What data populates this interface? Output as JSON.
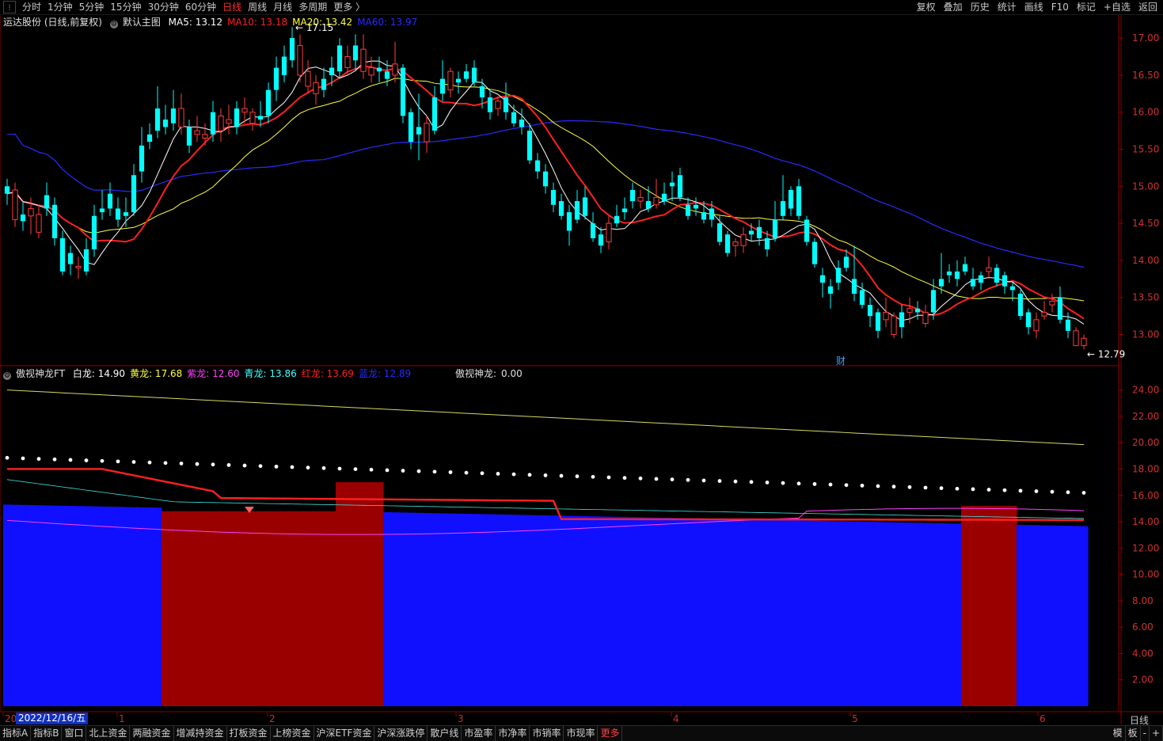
{
  "topbar": {
    "periods": [
      "分时",
      "1分钟",
      "5分钟",
      "15分钟",
      "30分钟",
      "60分钟",
      "日线",
      "周线",
      "月线",
      "多周期",
      "更多 〉"
    ],
    "active_period": "日线",
    "right_buttons": [
      "复权",
      "叠加",
      "历史",
      "统计",
      "画线",
      "F10",
      "标记",
      "+自选",
      "返回"
    ]
  },
  "main_panel": {
    "stock_label": "运达股份 (日线,前复权)",
    "template_label": "默认主图",
    "ma": [
      {
        "label": "MA5:",
        "value": "13.12",
        "color": "#ffffff"
      },
      {
        "label": "MA10:",
        "value": "13.18",
        "color": "#ff2020"
      },
      {
        "label": "MA20:",
        "value": "13.42",
        "color": "#ffff40"
      },
      {
        "label": "MA60:",
        "value": "13.97",
        "color": "#2a2aff"
      }
    ],
    "high_marker": "17.15",
    "low_marker": "12.79",
    "event_marker": "财",
    "y_ticks": [
      "17.00",
      "16.50",
      "16.00",
      "15.50",
      "15.00",
      "14.50",
      "14.00",
      "13.50",
      "13.00"
    ]
  },
  "sub_panel": {
    "indicator_label": "傲视神龙FT",
    "values": [
      {
        "label": "白龙:",
        "value": "14.90",
        "color": "#ffffff"
      },
      {
        "label": "黄龙:",
        "value": "17.68",
        "color": "#ffff40"
      },
      {
        "label": "紫龙:",
        "value": "12.60",
        "color": "#ff40ff"
      },
      {
        "label": "青龙:",
        "value": "13.86",
        "color": "#40ffff"
      },
      {
        "label": "红龙:",
        "value": "13.69",
        "color": "#ff2020"
      },
      {
        "label": "蓝龙:",
        "value": "12.89",
        "color": "#2a2aff"
      }
    ],
    "extra_label": "傲视神龙:",
    "extra_value": "0.00",
    "y_ticks": [
      "24.00",
      "22.00",
      "20.00",
      "18.00",
      "16.00",
      "14.00",
      "12.00",
      "10.00",
      "8.00",
      "6.00",
      "4.00",
      "2.00"
    ]
  },
  "xaxis": {
    "cursor_date": "2022/12/16/五",
    "year_prefix": "20",
    "month_ticks": [
      "1",
      "2",
      "3",
      "4",
      "5",
      "6"
    ],
    "period_label": "日线"
  },
  "bottombar": {
    "tabs": [
      "指标A",
      "指标B",
      "窗口",
      "北上资金",
      "两融资金",
      "增减持资金",
      "打板资金",
      "上榜资金",
      "沪深ETF资金",
      "沪深涨跌停",
      "散户线",
      "市盈率",
      "市净率",
      "市销率",
      "市现率",
      "更多"
    ],
    "right": [
      "模",
      "板",
      "-",
      "+"
    ]
  },
  "chart_data": {
    "type": "candlestick",
    "candles": [
      [
        15.0,
        14.9,
        15.1,
        14.75
      ],
      [
        14.55,
        14.95,
        15.05,
        14.45
      ],
      [
        14.62,
        14.53,
        14.8,
        14.4
      ],
      [
        14.6,
        14.7,
        14.85,
        14.35
      ],
      [
        14.38,
        14.62,
        14.75,
        14.3
      ],
      [
        14.88,
        14.7,
        15.05,
        14.6
      ],
      [
        14.75,
        14.3,
        14.85,
        14.2
      ],
      [
        14.3,
        13.85,
        14.4,
        13.8
      ],
      [
        14.1,
        13.95,
        14.2,
        13.8
      ],
      [
        13.9,
        13.92,
        14.05,
        13.75
      ],
      [
        14.15,
        13.85,
        14.3,
        13.8
      ],
      [
        14.6,
        14.15,
        14.75,
        14.05
      ],
      [
        14.7,
        14.65,
        14.95,
        14.55
      ],
      [
        14.9,
        14.7,
        15.05,
        14.6
      ],
      [
        14.7,
        14.55,
        14.85,
        14.45
      ],
      [
        14.65,
        14.6,
        14.85,
        14.45
      ],
      [
        15.15,
        14.65,
        15.3,
        14.6
      ],
      [
        15.55,
        15.2,
        15.8,
        15.05
      ],
      [
        15.7,
        15.6,
        15.85,
        15.5
      ],
      [
        16.05,
        15.75,
        16.35,
        15.65
      ],
      [
        15.9,
        15.8,
        16.1,
        15.7
      ],
      [
        16.05,
        15.85,
        16.3,
        15.75
      ],
      [
        15.8,
        16.05,
        16.25,
        15.7
      ],
      [
        15.8,
        15.55,
        15.9,
        15.45
      ],
      [
        15.7,
        15.75,
        15.95,
        15.6
      ],
      [
        15.65,
        15.7,
        15.85,
        15.55
      ],
      [
        16.0,
        15.7,
        16.15,
        15.6
      ],
      [
        15.75,
        15.95,
        16.05,
        15.6
      ],
      [
        15.85,
        15.9,
        16.1,
        15.7
      ],
      [
        16.05,
        15.8,
        16.15,
        15.7
      ],
      [
        16.0,
        16.05,
        16.2,
        15.85
      ],
      [
        15.85,
        16.0,
        16.05,
        15.75
      ],
      [
        15.95,
        15.9,
        16.15,
        15.8
      ],
      [
        16.3,
        15.95,
        16.4,
        15.85
      ],
      [
        16.6,
        16.3,
        16.75,
        16.15
      ],
      [
        16.75,
        16.5,
        16.9,
        16.4
      ],
      [
        17.0,
        16.7,
        17.15,
        16.6
      ],
      [
        16.5,
        16.9,
        17.05,
        16.4
      ],
      [
        16.35,
        16.55,
        16.7,
        16.25
      ],
      [
        16.25,
        16.4,
        16.5,
        16.1
      ],
      [
        16.45,
        16.3,
        16.6,
        16.2
      ],
      [
        16.6,
        16.5,
        16.75,
        16.35
      ],
      [
        16.9,
        16.55,
        17.0,
        16.45
      ],
      [
        16.6,
        16.75,
        16.9,
        16.5
      ],
      [
        16.9,
        16.7,
        17.05,
        16.55
      ],
      [
        16.55,
        16.85,
        17.05,
        16.45
      ],
      [
        16.5,
        16.6,
        16.75,
        16.4
      ],
      [
        16.6,
        16.55,
        16.75,
        16.4
      ],
      [
        16.55,
        16.45,
        16.7,
        16.35
      ],
      [
        16.5,
        16.65,
        16.95,
        16.4
      ],
      [
        16.6,
        15.95,
        16.65,
        15.85
      ],
      [
        16.0,
        15.6,
        16.05,
        15.5
      ],
      [
        15.8,
        15.7,
        16.25,
        15.35
      ],
      [
        15.6,
        15.85,
        15.95,
        15.45
      ],
      [
        16.2,
        15.75,
        16.35,
        15.7
      ],
      [
        16.45,
        16.25,
        16.7,
        16.15
      ],
      [
        16.3,
        16.55,
        16.6,
        16.2
      ],
      [
        16.45,
        16.4,
        16.55,
        16.25
      ],
      [
        16.55,
        16.45,
        16.65,
        16.4
      ],
      [
        16.6,
        16.4,
        16.7,
        16.35
      ],
      [
        16.35,
        16.2,
        16.45,
        16.05
      ],
      [
        16.2,
        16.0,
        16.3,
        15.9
      ],
      [
        16.05,
        16.15,
        16.2,
        15.95
      ],
      [
        16.2,
        16.0,
        16.4,
        15.9
      ],
      [
        16.0,
        15.85,
        16.1,
        15.8
      ],
      [
        15.9,
        15.8,
        16.05,
        15.7
      ],
      [
        15.75,
        15.35,
        15.85,
        15.3
      ],
      [
        15.35,
        15.2,
        15.45,
        15.1
      ],
      [
        15.2,
        15.0,
        15.3,
        14.9
      ],
      [
        14.95,
        14.75,
        15.05,
        14.65
      ],
      [
        14.8,
        14.6,
        14.9,
        14.55
      ],
      [
        14.65,
        14.4,
        14.75,
        14.2
      ],
      [
        14.8,
        14.55,
        14.95,
        14.5
      ],
      [
        14.85,
        14.6,
        15.0,
        14.55
      ],
      [
        14.5,
        14.3,
        14.65,
        14.25
      ],
      [
        14.35,
        14.2,
        14.45,
        14.1
      ],
      [
        14.25,
        14.5,
        14.6,
        14.15
      ],
      [
        14.6,
        14.5,
        14.75,
        14.45
      ],
      [
        14.7,
        14.65,
        14.85,
        14.55
      ],
      [
        14.95,
        14.8,
        15.05,
        14.7
      ],
      [
        14.8,
        14.85,
        14.95,
        14.7
      ],
      [
        14.8,
        14.7,
        15.0,
        14.65
      ],
      [
        14.75,
        14.85,
        15.1,
        14.7
      ],
      [
        14.9,
        14.8,
        15.05,
        14.75
      ],
      [
        15.05,
        15.0,
        15.2,
        14.8
      ],
      [
        15.15,
        14.85,
        15.25,
        14.8
      ],
      [
        14.75,
        14.6,
        14.85,
        14.55
      ],
      [
        14.75,
        14.7,
        14.85,
        14.6
      ],
      [
        14.65,
        14.55,
        14.8,
        14.5
      ],
      [
        14.7,
        14.55,
        14.8,
        14.45
      ],
      [
        14.5,
        14.25,
        14.6,
        14.2
      ],
      [
        14.35,
        14.1,
        14.4,
        14.05
      ],
      [
        14.2,
        14.25,
        14.3,
        14.05
      ],
      [
        14.2,
        14.35,
        14.45,
        14.1
      ],
      [
        14.4,
        14.35,
        14.5,
        14.25
      ],
      [
        14.45,
        14.3,
        14.55,
        14.2
      ],
      [
        14.3,
        14.15,
        14.4,
        14.05
      ],
      [
        14.55,
        14.3,
        14.8,
        14.25
      ],
      [
        14.8,
        14.6,
        15.15,
        14.55
      ],
      [
        14.95,
        14.7,
        15.0,
        14.6
      ],
      [
        15.0,
        14.6,
        15.1,
        14.55
      ],
      [
        14.55,
        14.25,
        14.6,
        14.2
      ],
      [
        14.25,
        13.95,
        14.3,
        13.9
      ],
      [
        13.8,
        13.7,
        13.9,
        13.5
      ],
      [
        13.65,
        13.55,
        13.75,
        13.35
      ],
      [
        13.9,
        13.7,
        14.0,
        13.6
      ],
      [
        14.05,
        13.9,
        14.15,
        13.85
      ],
      [
        13.75,
        13.55,
        14.2,
        13.45
      ],
      [
        13.6,
        13.4,
        13.7,
        13.35
      ],
      [
        13.4,
        13.25,
        13.5,
        13.1
      ],
      [
        13.3,
        13.05,
        13.35,
        12.95
      ],
      [
        13.2,
        13.3,
        13.5,
        13.1
      ],
      [
        13.0,
        13.25,
        13.3,
        12.95
      ],
      [
        13.3,
        13.1,
        13.4,
        12.95
      ],
      [
        13.3,
        13.35,
        13.5,
        13.15
      ],
      [
        13.35,
        13.3,
        13.45,
        13.2
      ],
      [
        13.15,
        13.3,
        13.4,
        13.1
      ],
      [
        13.6,
        13.3,
        13.75,
        13.2
      ],
      [
        13.75,
        13.65,
        14.1,
        13.55
      ],
      [
        13.85,
        13.8,
        13.95,
        13.7
      ],
      [
        13.85,
        13.75,
        14.0,
        13.65
      ],
      [
        13.95,
        13.85,
        14.05,
        13.8
      ],
      [
        13.75,
        13.65,
        13.9,
        13.6
      ],
      [
        13.8,
        13.7,
        13.85,
        13.6
      ],
      [
        13.85,
        13.9,
        14.05,
        13.75
      ],
      [
        13.9,
        13.7,
        13.95,
        13.65
      ],
      [
        13.8,
        13.65,
        13.85,
        13.55
      ],
      [
        13.65,
        13.6,
        13.7,
        13.45
      ],
      [
        13.55,
        13.25,
        13.6,
        13.2
      ],
      [
        13.3,
        13.1,
        13.35,
        13.0
      ],
      [
        13.05,
        13.2,
        13.3,
        12.95
      ],
      [
        13.25,
        13.3,
        13.45,
        13.2
      ],
      [
        13.4,
        13.45,
        13.55,
        13.3
      ],
      [
        13.5,
        13.2,
        13.65,
        13.15
      ],
      [
        13.2,
        13.05,
        13.3,
        12.95
      ],
      [
        12.85,
        13.05,
        13.1,
        12.85
      ],
      [
        12.85,
        12.95,
        13.0,
        12.8
      ]
    ],
    "up_color": "#ff3c3c",
    "down_color": "#00ffff",
    "ma_colors": {
      "MA5": "#ffffff",
      "MA10": "#ff2020",
      "MA20": "#ffff40",
      "MA60": "#2a2aff"
    },
    "main_ylim": [
      12.6,
      17.3
    ],
    "sub_ylim": [
      0,
      25
    ]
  }
}
